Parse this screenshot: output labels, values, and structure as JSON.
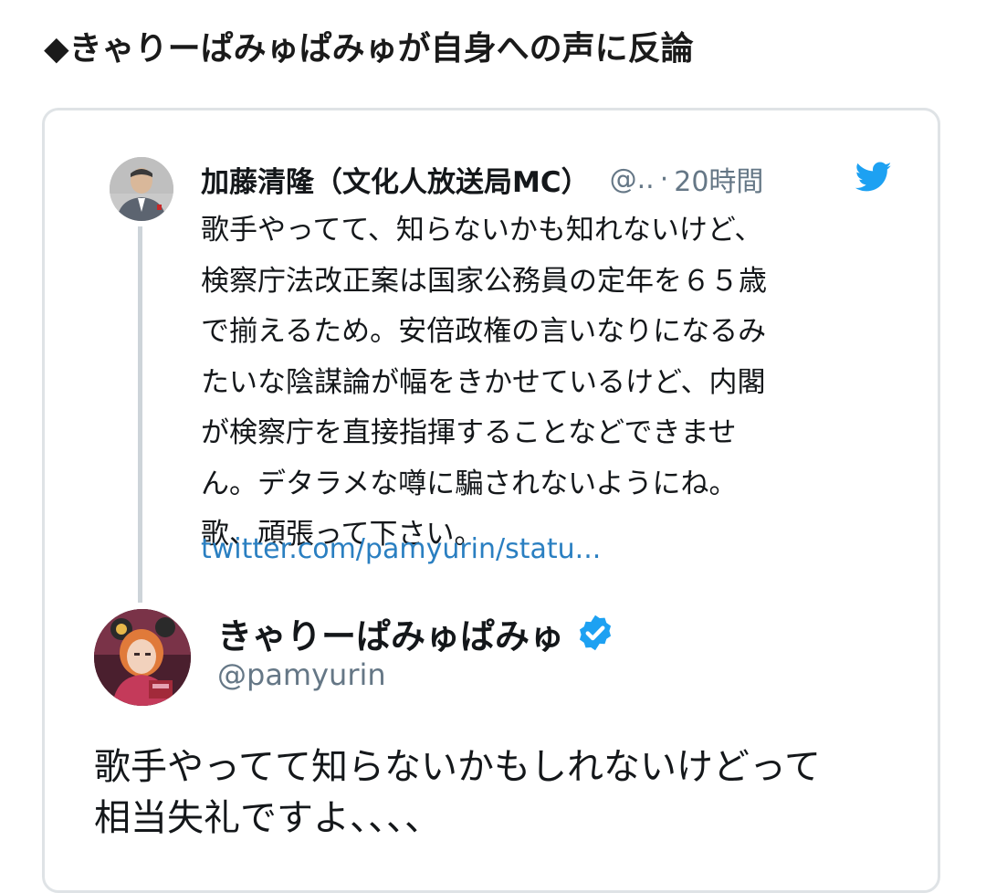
{
  "heading": "◆きゃりーぱみゅぱみゅが自身への声に反論",
  "parent_tweet": {
    "author_name": "加藤清隆（文化人放送局MC）",
    "handle": "@..",
    "separator": "·",
    "time": "20時間",
    "body_lines": [
      "歌手やってて、知らないかも知れないけど、",
      "検察庁法改正案は国家公務員の定年を６５歳",
      "で揃えるため。安倍政権の言いなりになるみ",
      "たいな陰謀論が幅をきかせているけど、内閣",
      "が検察庁を直接指揮することなどできませ",
      "ん。デタラメな噂に騙されないようにね。",
      "歌、頑張って下さい。"
    ],
    "link": "twitter.com/pamyurin/statu..."
  },
  "reply_tweet": {
    "author_name": "きゃりーぱみゅぱみゅ",
    "handle": "@pamyurin",
    "body_lines": [
      "歌手やってて知らないかもしれないけどって",
      "相当失礼ですよ、、、、"
    ]
  },
  "colors": {
    "twitter_blue": "#1da1f2",
    "link_blue": "#2a7fc1",
    "muted_gray": "#657786",
    "card_border": "#dfe3e6",
    "thread_line": "#cdd4d9"
  },
  "icons": {
    "twitter_logo": "twitter-bird-icon",
    "verified_badge": "verified-badge-icon"
  }
}
